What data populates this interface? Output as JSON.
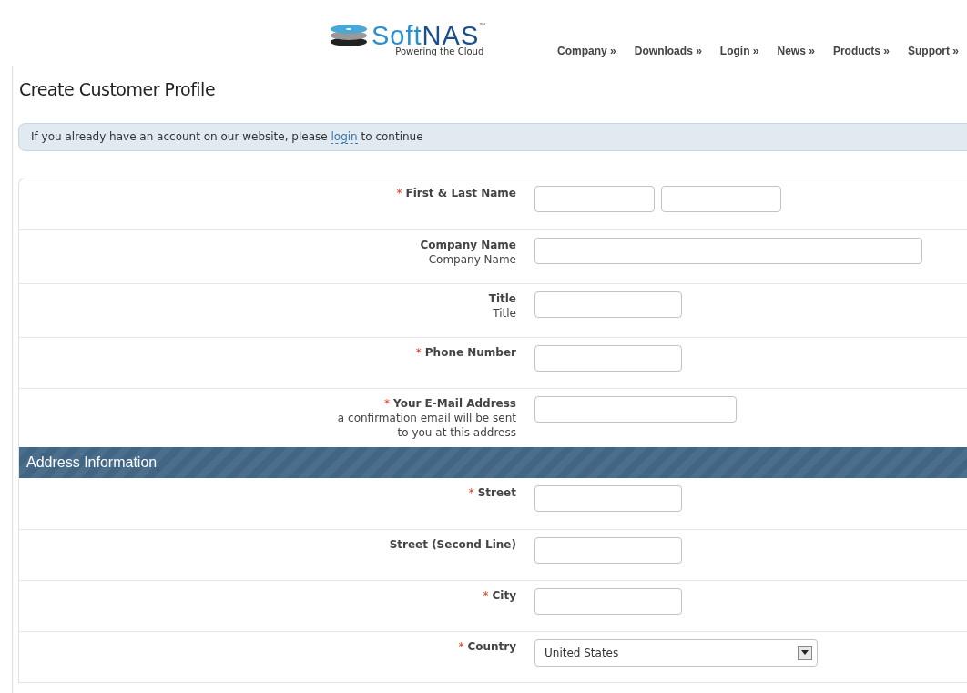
{
  "logo": {
    "brand_part1": "Soft",
    "brand_part2": "NAS",
    "trademark": "™",
    "tagline": "Powering the Cloud"
  },
  "nav": [
    {
      "label": "Company",
      "arrow": "»"
    },
    {
      "label": "Downloads",
      "arrow": "»"
    },
    {
      "label": "Login",
      "arrow": "»"
    },
    {
      "label": "News",
      "arrow": "»"
    },
    {
      "label": "Products",
      "arrow": "»"
    },
    {
      "label": "Support",
      "arrow": "»"
    }
  ],
  "page_title": "Create Customer Profile",
  "notice": {
    "before": "If you already have an account on our website, please",
    "link": "login",
    "after": "to continue"
  },
  "required_mark": "*",
  "sections": [
    {
      "fields": [
        {
          "label": "First & Last Name",
          "required": true,
          "inputs": [
            {
              "kind": "short"
            },
            {
              "kind": "short"
            }
          ]
        },
        {
          "label": "Company Name",
          "note": "Company Name",
          "required": false,
          "inputs": [
            {
              "kind": "wide"
            }
          ]
        },
        {
          "label": "Title",
          "note": "Title",
          "required": false,
          "inputs": [
            {
              "kind": "medium"
            }
          ]
        },
        {
          "label": "Phone Number",
          "required": true,
          "inputs": [
            {
              "kind": "medium"
            }
          ]
        },
        {
          "label": "Your E-Mail Address",
          "note": "a confirmation email will be sent to you at this address",
          "required": true,
          "inputs": [
            {
              "kind": "long"
            }
          ]
        }
      ]
    },
    {
      "heading": "Address Information",
      "fields": [
        {
          "label": "Street",
          "required": true,
          "inputs": [
            {
              "kind": "medium"
            }
          ]
        },
        {
          "label": "Street (Second Line)",
          "required": false,
          "inputs": [
            {
              "kind": "medium"
            }
          ]
        },
        {
          "label": "City",
          "required": true,
          "inputs": [
            {
              "kind": "medium"
            }
          ]
        },
        {
          "label": "Country",
          "required": true,
          "inputs": [
            {
              "kind": "select",
              "value": "United States"
            }
          ]
        }
      ]
    }
  ]
}
